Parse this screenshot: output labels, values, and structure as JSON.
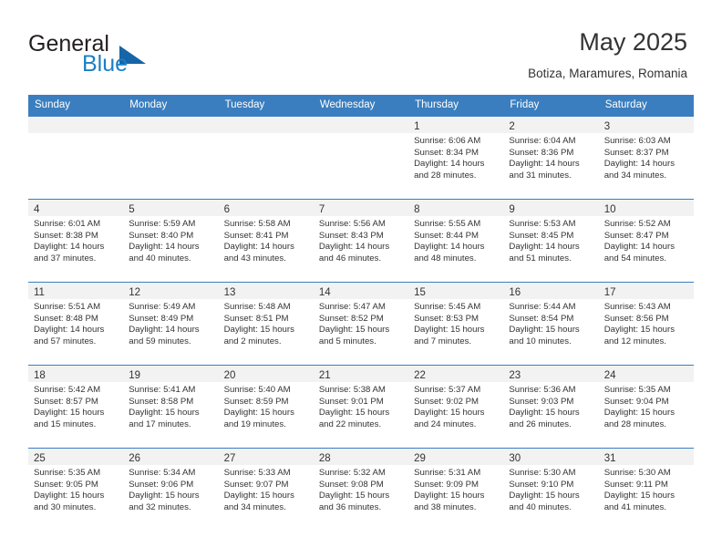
{
  "brand": {
    "line1": "General",
    "line2": "Blue",
    "triangle_icon": "triangle-icon",
    "accent_color": "#1b7fc4"
  },
  "header": {
    "title": "May 2025",
    "subtitle": "Botiza, Maramures, Romania"
  },
  "theme": {
    "header_bg": "#3a7ebf",
    "daynum_bg": "#f2f2f2",
    "text": "#333333"
  },
  "weekdays": [
    "Sunday",
    "Monday",
    "Tuesday",
    "Wednesday",
    "Thursday",
    "Friday",
    "Saturday"
  ],
  "weeks": [
    [
      {
        "day": "",
        "lines": []
      },
      {
        "day": "",
        "lines": []
      },
      {
        "day": "",
        "lines": []
      },
      {
        "day": "",
        "lines": []
      },
      {
        "day": "1",
        "lines": [
          "Sunrise: 6:06 AM",
          "Sunset: 8:34 PM",
          "Daylight: 14 hours",
          "and 28 minutes."
        ]
      },
      {
        "day": "2",
        "lines": [
          "Sunrise: 6:04 AM",
          "Sunset: 8:36 PM",
          "Daylight: 14 hours",
          "and 31 minutes."
        ]
      },
      {
        "day": "3",
        "lines": [
          "Sunrise: 6:03 AM",
          "Sunset: 8:37 PM",
          "Daylight: 14 hours",
          "and 34 minutes."
        ]
      }
    ],
    [
      {
        "day": "4",
        "lines": [
          "Sunrise: 6:01 AM",
          "Sunset: 8:38 PM",
          "Daylight: 14 hours",
          "and 37 minutes."
        ]
      },
      {
        "day": "5",
        "lines": [
          "Sunrise: 5:59 AM",
          "Sunset: 8:40 PM",
          "Daylight: 14 hours",
          "and 40 minutes."
        ]
      },
      {
        "day": "6",
        "lines": [
          "Sunrise: 5:58 AM",
          "Sunset: 8:41 PM",
          "Daylight: 14 hours",
          "and 43 minutes."
        ]
      },
      {
        "day": "7",
        "lines": [
          "Sunrise: 5:56 AM",
          "Sunset: 8:43 PM",
          "Daylight: 14 hours",
          "and 46 minutes."
        ]
      },
      {
        "day": "8",
        "lines": [
          "Sunrise: 5:55 AM",
          "Sunset: 8:44 PM",
          "Daylight: 14 hours",
          "and 48 minutes."
        ]
      },
      {
        "day": "9",
        "lines": [
          "Sunrise: 5:53 AM",
          "Sunset: 8:45 PM",
          "Daylight: 14 hours",
          "and 51 minutes."
        ]
      },
      {
        "day": "10",
        "lines": [
          "Sunrise: 5:52 AM",
          "Sunset: 8:47 PM",
          "Daylight: 14 hours",
          "and 54 minutes."
        ]
      }
    ],
    [
      {
        "day": "11",
        "lines": [
          "Sunrise: 5:51 AM",
          "Sunset: 8:48 PM",
          "Daylight: 14 hours",
          "and 57 minutes."
        ]
      },
      {
        "day": "12",
        "lines": [
          "Sunrise: 5:49 AM",
          "Sunset: 8:49 PM",
          "Daylight: 14 hours",
          "and 59 minutes."
        ]
      },
      {
        "day": "13",
        "lines": [
          "Sunrise: 5:48 AM",
          "Sunset: 8:51 PM",
          "Daylight: 15 hours",
          "and 2 minutes."
        ]
      },
      {
        "day": "14",
        "lines": [
          "Sunrise: 5:47 AM",
          "Sunset: 8:52 PM",
          "Daylight: 15 hours",
          "and 5 minutes."
        ]
      },
      {
        "day": "15",
        "lines": [
          "Sunrise: 5:45 AM",
          "Sunset: 8:53 PM",
          "Daylight: 15 hours",
          "and 7 minutes."
        ]
      },
      {
        "day": "16",
        "lines": [
          "Sunrise: 5:44 AM",
          "Sunset: 8:54 PM",
          "Daylight: 15 hours",
          "and 10 minutes."
        ]
      },
      {
        "day": "17",
        "lines": [
          "Sunrise: 5:43 AM",
          "Sunset: 8:56 PM",
          "Daylight: 15 hours",
          "and 12 minutes."
        ]
      }
    ],
    [
      {
        "day": "18",
        "lines": [
          "Sunrise: 5:42 AM",
          "Sunset: 8:57 PM",
          "Daylight: 15 hours",
          "and 15 minutes."
        ]
      },
      {
        "day": "19",
        "lines": [
          "Sunrise: 5:41 AM",
          "Sunset: 8:58 PM",
          "Daylight: 15 hours",
          "and 17 minutes."
        ]
      },
      {
        "day": "20",
        "lines": [
          "Sunrise: 5:40 AM",
          "Sunset: 8:59 PM",
          "Daylight: 15 hours",
          "and 19 minutes."
        ]
      },
      {
        "day": "21",
        "lines": [
          "Sunrise: 5:38 AM",
          "Sunset: 9:01 PM",
          "Daylight: 15 hours",
          "and 22 minutes."
        ]
      },
      {
        "day": "22",
        "lines": [
          "Sunrise: 5:37 AM",
          "Sunset: 9:02 PM",
          "Daylight: 15 hours",
          "and 24 minutes."
        ]
      },
      {
        "day": "23",
        "lines": [
          "Sunrise: 5:36 AM",
          "Sunset: 9:03 PM",
          "Daylight: 15 hours",
          "and 26 minutes."
        ]
      },
      {
        "day": "24",
        "lines": [
          "Sunrise: 5:35 AM",
          "Sunset: 9:04 PM",
          "Daylight: 15 hours",
          "and 28 minutes."
        ]
      }
    ],
    [
      {
        "day": "25",
        "lines": [
          "Sunrise: 5:35 AM",
          "Sunset: 9:05 PM",
          "Daylight: 15 hours",
          "and 30 minutes."
        ]
      },
      {
        "day": "26",
        "lines": [
          "Sunrise: 5:34 AM",
          "Sunset: 9:06 PM",
          "Daylight: 15 hours",
          "and 32 minutes."
        ]
      },
      {
        "day": "27",
        "lines": [
          "Sunrise: 5:33 AM",
          "Sunset: 9:07 PM",
          "Daylight: 15 hours",
          "and 34 minutes."
        ]
      },
      {
        "day": "28",
        "lines": [
          "Sunrise: 5:32 AM",
          "Sunset: 9:08 PM",
          "Daylight: 15 hours",
          "and 36 minutes."
        ]
      },
      {
        "day": "29",
        "lines": [
          "Sunrise: 5:31 AM",
          "Sunset: 9:09 PM",
          "Daylight: 15 hours",
          "and 38 minutes."
        ]
      },
      {
        "day": "30",
        "lines": [
          "Sunrise: 5:30 AM",
          "Sunset: 9:10 PM",
          "Daylight: 15 hours",
          "and 40 minutes."
        ]
      },
      {
        "day": "31",
        "lines": [
          "Sunrise: 5:30 AM",
          "Sunset: 9:11 PM",
          "Daylight: 15 hours",
          "and 41 minutes."
        ]
      }
    ]
  ]
}
